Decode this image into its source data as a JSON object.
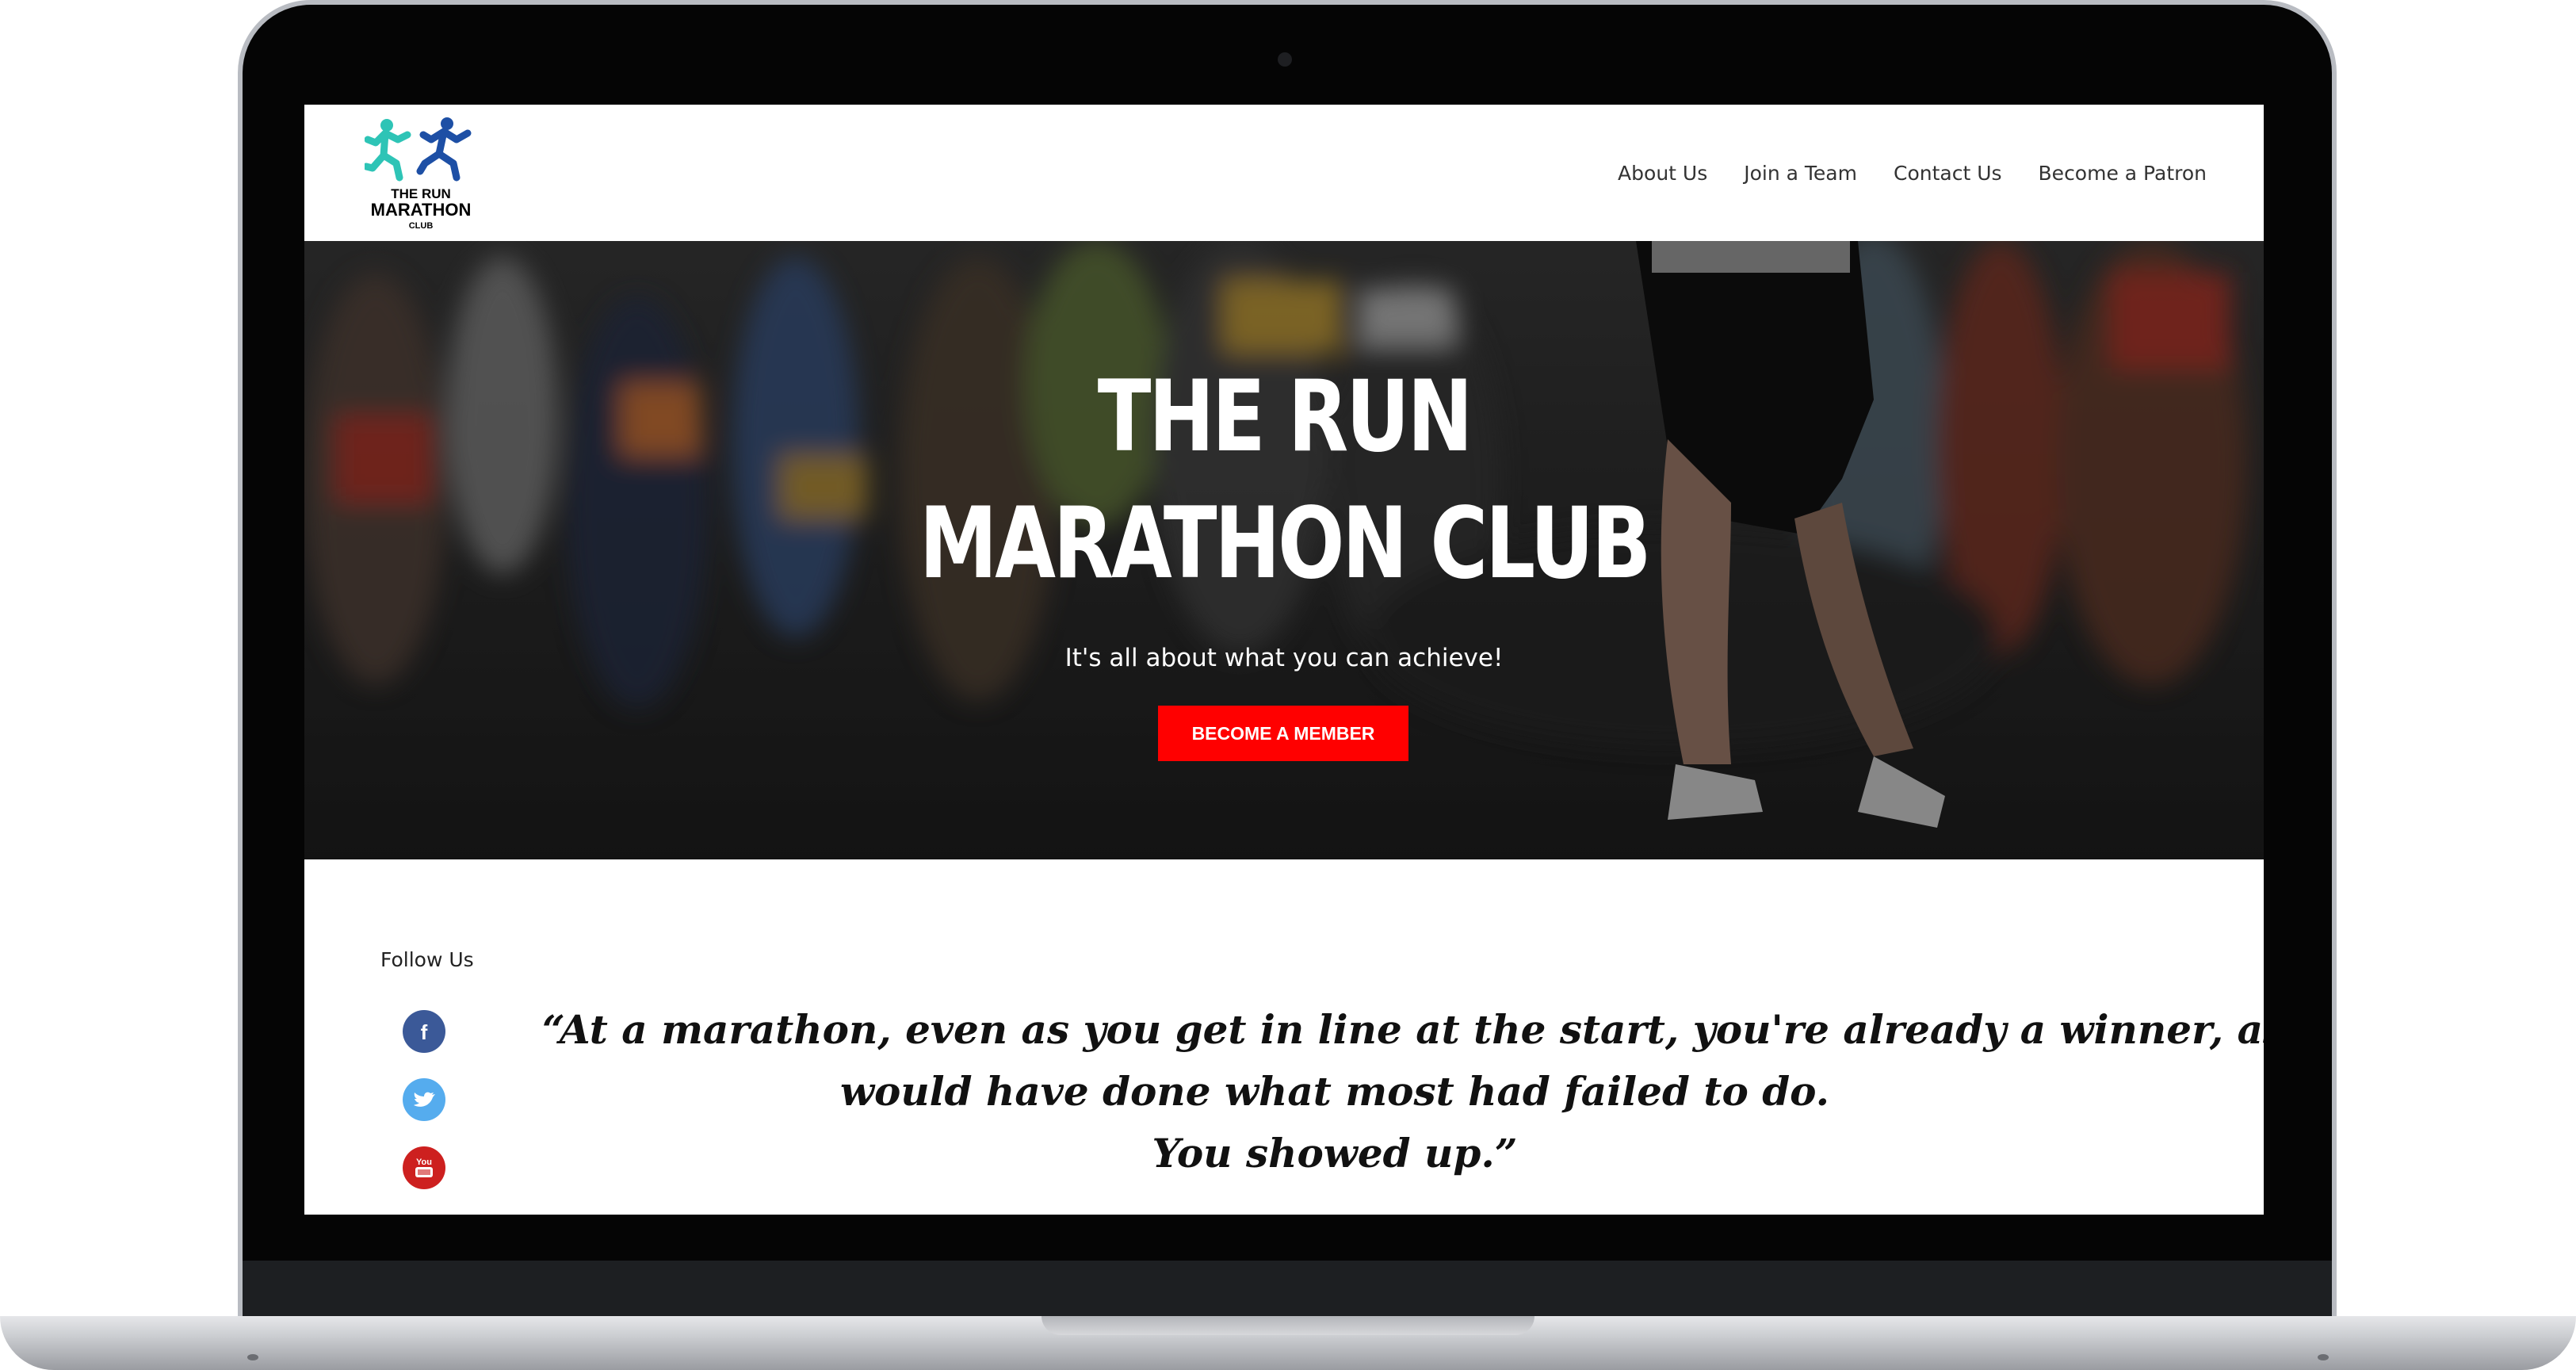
{
  "header": {
    "logo": {
      "text_line1": "THE RUN",
      "text_line2": "MARATHON",
      "text_line3": "CLUB",
      "runner_colors": [
        "#2ec4b6",
        "#1d4fa5"
      ]
    },
    "nav": [
      "About Us",
      "Join a Team",
      "Contact Us",
      "Become a Patron"
    ]
  },
  "hero": {
    "title_line1": "THE RUN",
    "title_line2": "MARATHON CLUB",
    "subtitle": "It's all about what you can achieve!",
    "cta_label": "BECOME A MEMBER",
    "cta_color": "#ff0000"
  },
  "follow": {
    "label": "Follow Us",
    "socials": [
      {
        "name": "facebook-icon",
        "glyph": "f",
        "color": "#3b5998"
      },
      {
        "name": "twitter-icon",
        "glyph": "",
        "color": "#55acee"
      },
      {
        "name": "youtube-icon",
        "glyph": "You",
        "color": "#cd201f"
      }
    ]
  },
  "quote": {
    "line1": "“At a marathon, even as you get in line at the start, you're already a winner, as you",
    "line2": "would have done what most had failed to do.",
    "line3": "You showed up.”"
  }
}
